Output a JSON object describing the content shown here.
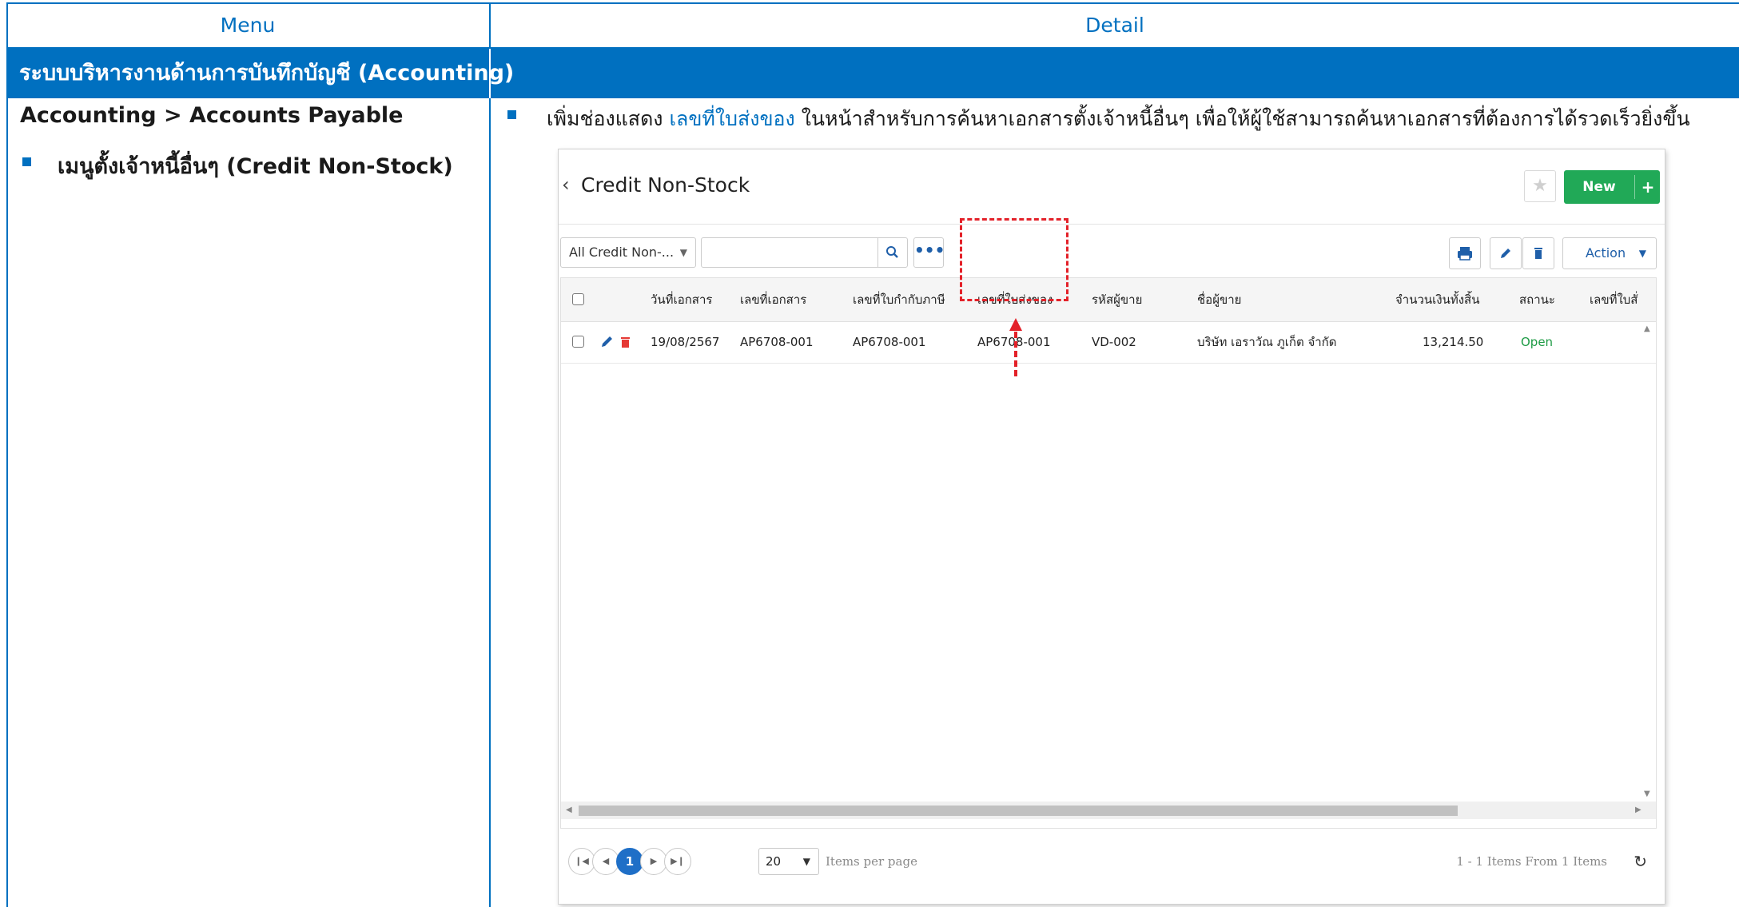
{
  "doc": {
    "header_menu": "Menu",
    "header_detail": "Detail",
    "section_title": "ระบบบริหารงานด้านการบันทึกบัญชี (Accounting)",
    "menu_path": "Accounting > Accounts Payable",
    "menu_item": "เมนูตั้งเจ้าหนี้อื่นๆ (Credit Non-Stock)",
    "detail_prefix": "เพิ่มช่องแสดง ",
    "detail_highlight": "เลขที่ใบส่งของ",
    "detail_suffix": " ในหน้าสำหรับการค้นหาเอกสารตั้งเจ้าหนี้อื่นๆ เพื่อให้ผู้ใช้สามารถค้นหาเอกสารที่ต้องการได้รวดเร็วยิ่งขึ้น"
  },
  "app": {
    "back_icon": "chevron-left-icon",
    "title": "Credit Non-Stock",
    "favorite_icon": "star-icon",
    "new_label": "New",
    "new_plus": "+",
    "filter_value": "All Credit Non-...",
    "search_value": "",
    "search_icon": "search-icon",
    "more_label": "•••",
    "print_icon": "printer-icon",
    "edit_icon": "pencil-icon",
    "delete_icon": "trash-icon",
    "action_label": "Action",
    "columns": [
      "วันที่เอกสาร",
      "เลขที่เอกสาร",
      "เลขที่ใบกำกับภาษี",
      "เลขที่ใบส่งของ",
      "รหัสผู้ขาย",
      "ชื่อผู้ขาย",
      "จำนวนเงินทั้งสิ้น",
      "สถานะ",
      "เลขที่ใบสั่"
    ],
    "rows": [
      {
        "doc_date": "19/08/2567",
        "doc_no": "AP6708-001",
        "tax_invoice_no": "AP6708-001",
        "delivery_no": "AP6708-001",
        "vendor_code": "VD-002",
        "vendor_name": "บริษัท เอราวัณ ภูเก็ต จำกัด",
        "amount": "13,214.50",
        "status": "Open",
        "po_no": ""
      }
    ],
    "pager": {
      "current_page": "1",
      "page_size": "20",
      "items_per_page_label": "Items per page",
      "info": "1 - 1 Items From 1 Items"
    },
    "colors": {
      "accent": "#0070c0",
      "new_button": "#21a957",
      "status_open": "#1e9b45",
      "highlight": "#e32129"
    }
  }
}
